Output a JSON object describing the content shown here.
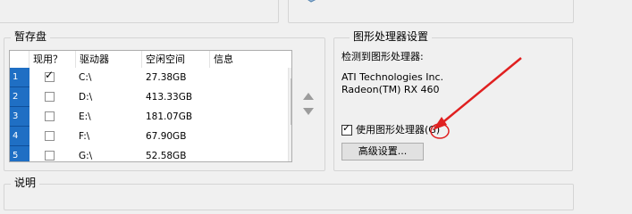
{
  "scratch": {
    "legend": "暂存盘",
    "columns": [
      "现用？",
      "驱动器",
      "空闲空间",
      "信息"
    ],
    "rows": [
      {
        "num": "1",
        "active": true,
        "drive": "C:\\",
        "free": "27.38GB",
        "info": ""
      },
      {
        "num": "2",
        "active": false,
        "drive": "D:\\",
        "free": "413.33GB",
        "info": ""
      },
      {
        "num": "3",
        "active": false,
        "drive": "E:\\",
        "free": "181.07GB",
        "info": ""
      },
      {
        "num": "4",
        "active": false,
        "drive": "F:\\",
        "free": "67.90GB",
        "info": ""
      },
      {
        "num": "5",
        "active": false,
        "drive": "G:\\",
        "free": "52.58GB",
        "info": ""
      }
    ]
  },
  "gpu": {
    "legend": "图形处理器设置",
    "detected_label": "检测到图形处理器:",
    "vendor": "ATI Technologies Inc.",
    "model": "Radeon(TM) RX 460",
    "use_gpu_checked": true,
    "use_gpu_label": "使用图形处理器(G)",
    "advanced_button": "高级设置..."
  },
  "description": {
    "legend": "说明"
  },
  "annotation": {
    "color": "#e02020"
  }
}
